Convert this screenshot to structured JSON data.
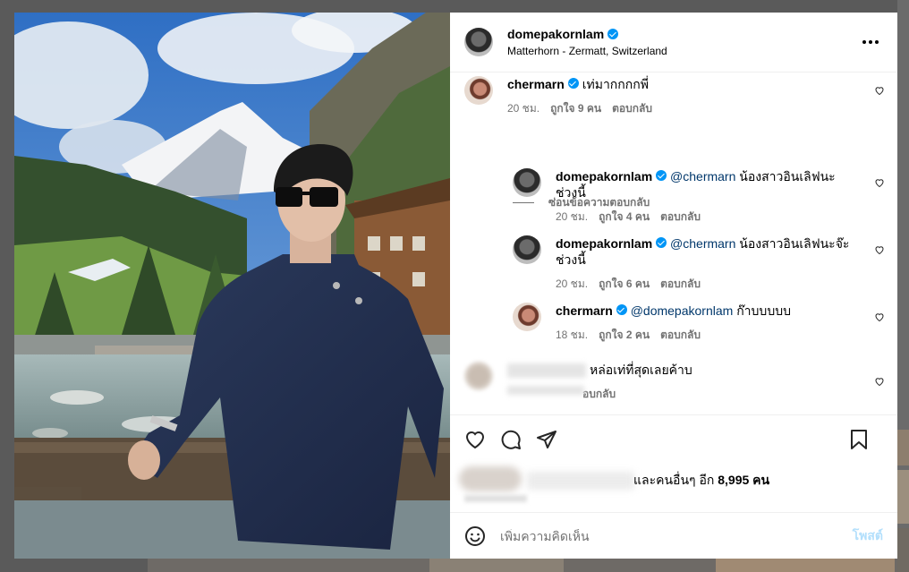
{
  "post": {
    "username": "domepakornlam",
    "location": "Matterhorn - Zermatt, Switzerland"
  },
  "comments": [
    {
      "username": "chermarn",
      "text": "เท่มากกกกพี่",
      "time": "20 ชม.",
      "likes": "ถูกใจ 9 คน",
      "reply_label": "ตอบกลับ"
    }
  ],
  "hide_replies_label": "ซ่อนข้อความตอบกลับ",
  "replies": [
    {
      "username": "domepakornlam",
      "mention": "@chermarn",
      "text": "น้องสาวอินเลิฟนะ",
      "text_line2": "ช่วงนี้",
      "time": "20 ชม.",
      "likes": "ถูกใจ 4 คน",
      "reply_label": "ตอบกลับ"
    },
    {
      "username": "domepakornlam",
      "mention": "@chermarn",
      "text": "น้องสาวอินเลิฟนะจ๊ะ",
      "text_line2": "ช่วงนี้",
      "time": "20 ชม.",
      "likes": "ถูกใจ 6 คน",
      "reply_label": "ตอบกลับ"
    },
    {
      "username": "chermarn",
      "mention": "@domepakornlam",
      "text": "ก๊าบบบบบ",
      "time": "18 ชม.",
      "likes": "ถูกใจ 2 คน",
      "reply_label": "ตอบกลับ"
    }
  ],
  "blurred_comment": {
    "text": "หล่อเท่ที่สุดเลยค้าบ",
    "reply_label": "อบกลับ"
  },
  "likes": {
    "text_prefix": "และคนอื่นๆ อีก",
    "count": "8,995",
    "suffix": "คน"
  },
  "add_comment": {
    "placeholder": "เพิ่มความคิดเห็น",
    "post_label": "โพสต์"
  },
  "icons": [
    "more-icon",
    "heart-icon",
    "comment-icon",
    "share-icon",
    "bookmark-icon",
    "emoji-icon",
    "verified-badge-icon"
  ],
  "colors": {
    "accent": "#0095f6",
    "post_disabled": "#b2dffc",
    "secondary_text": "#737373",
    "mention": "#00376b"
  }
}
